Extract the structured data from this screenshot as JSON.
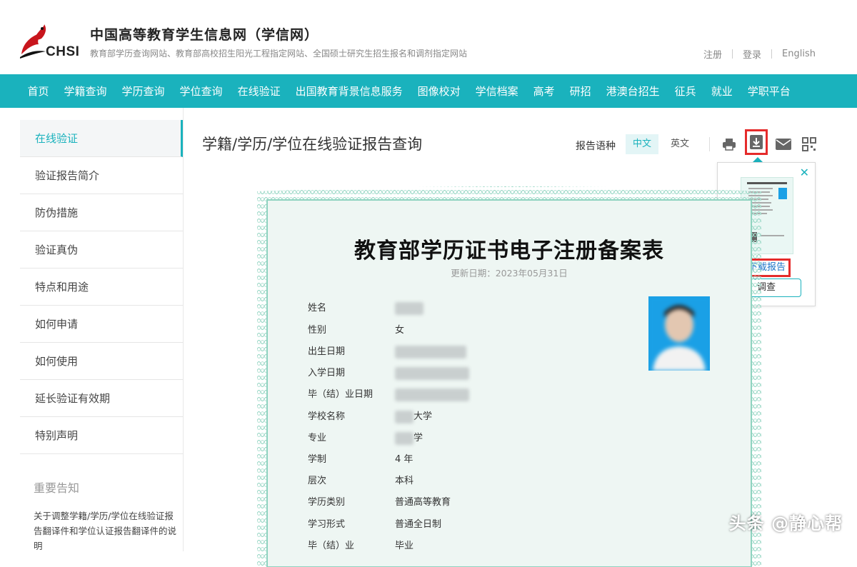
{
  "header": {
    "logo_text": "CHSI",
    "title": "中国高等教育学生信息网（学信网）",
    "subtitle": "教育部学历查询网站、教育部高校招生阳光工程指定网站、全国硕士研究生招生报名和调剂指定网站",
    "links": [
      "注册",
      "登录",
      "English"
    ]
  },
  "nav": [
    "首页",
    "学籍查询",
    "学历查询",
    "学位查询",
    "在线验证",
    "出国教育背景信息服务",
    "图像校对",
    "学信档案",
    "高考",
    "研招",
    "港澳台招生",
    "征兵",
    "就业",
    "学职平台"
  ],
  "sidebar": {
    "items": [
      "在线验证",
      "验证报告简介",
      "防伪措施",
      "验证真伪",
      "特点和用途",
      "如何申请",
      "如何使用",
      "延长验证有效期",
      "特别声明"
    ],
    "notice_title": "重要告知",
    "notice_text": "关于调整学籍/学历/学位在线验证报告翻译件和学位认证报告翻译件的说明"
  },
  "main": {
    "title": "学籍/学历/学位在线验证报告查询",
    "lang_label": "报告语种",
    "lang_options": [
      "中文",
      "英文"
    ]
  },
  "popup": {
    "download_label": "下载报告",
    "check_label": "调查"
  },
  "certificate": {
    "title": "教育部学历证书电子注册备案表",
    "date": "更新日期：2023年05月31日",
    "fields": [
      {
        "label": "姓名",
        "value": ""
      },
      {
        "label": "性别",
        "value": "女"
      },
      {
        "label": "出生日期",
        "value": ""
      },
      {
        "label": "入学日期",
        "value": ""
      },
      {
        "label": "毕（结）业日期",
        "value": ""
      },
      {
        "label": "学校名称",
        "value": "大学"
      },
      {
        "label": "专业",
        "value": "学"
      },
      {
        "label": "学制",
        "value": "4 年"
      },
      {
        "label": "层次",
        "value": "本科"
      },
      {
        "label": "学历类别",
        "value": "普通高等教育"
      },
      {
        "label": "学习形式",
        "value": "普通全日制"
      },
      {
        "label": "毕（结）业",
        "value": "毕业"
      }
    ]
  },
  "watermark": "头条 @静心帮",
  "colors": {
    "accent": "#1ab2bd",
    "highlight": "#e52b2b",
    "link": "#1a73c8"
  }
}
